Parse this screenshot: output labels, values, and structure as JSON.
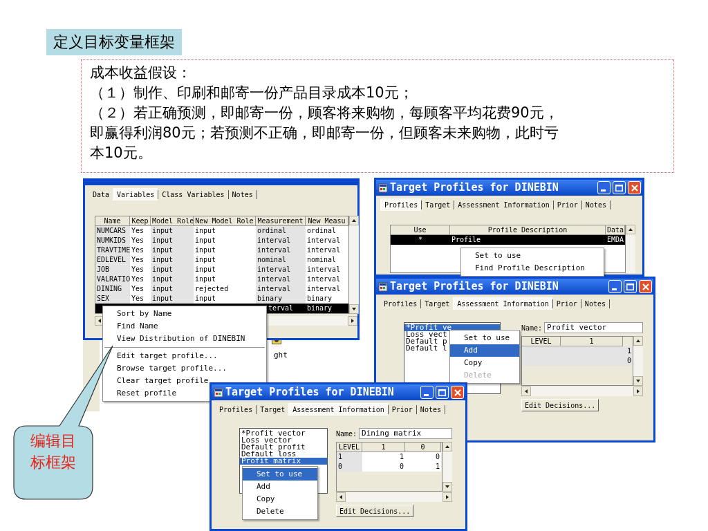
{
  "slide_title": "定义目标变量框架",
  "note_lines": [
    "成本收益假设：",
    "（１）制作、印刷和邮寄一份产品目录成本10元；",
    "（２）若正确预测，即邮寄一份，顾客将来购物，每顾客平均花费90元，",
    "即赢得利润80元；若预测不正确，即邮寄一份，但顾客未来购物，此时亏",
    "本10元。"
  ],
  "behind_text": "ght",
  "windows": [
    {
      "kind": "variables",
      "tabs": [
        {
          "label": "Data",
          "selected": false
        },
        {
          "label": "Variables",
          "selected": true
        },
        {
          "label": "Class Variables",
          "selected": false
        },
        {
          "label": "Notes",
          "selected": false
        }
      ],
      "table": {
        "columns": [
          "Name",
          "Keep",
          "Model Role",
          "New Model Role",
          "Measurement",
          "New Measu"
        ],
        "rows": [
          {
            "cells": [
              "NUMCARS",
              "Yes",
              "input",
              "input",
              "ordinal",
              "ordinal"
            ],
            "selected": false
          },
          {
            "cells": [
              "NUMKIDS",
              "Yes",
              "input",
              "input",
              "interval",
              "interval"
            ],
            "selected": false
          },
          {
            "cells": [
              "TRAVTIME",
              "Yes",
              "input",
              "input",
              "interval",
              "interval"
            ],
            "selected": false
          },
          {
            "cells": [
              "EDLEVEL",
              "Yes",
              "input",
              "input",
              "nominal",
              "nominal"
            ],
            "selected": false
          },
          {
            "cells": [
              "JOB",
              "Yes",
              "input",
              "input",
              "interval",
              "interval"
            ],
            "selected": false
          },
          {
            "cells": [
              "VALRATIO",
              "Yes",
              "input",
              "input",
              "interval",
              "interval"
            ],
            "selected": false
          },
          {
            "cells": [
              "DINING",
              "Yes",
              "input",
              "rejected",
              "interval",
              "interval"
            ],
            "selected": false
          },
          {
            "cells": [
              "SEX",
              "Yes",
              "input",
              "input",
              "binary",
              "binary"
            ],
            "selected": false
          },
          {
            "cells": [
              "",
              "",
              "",
              "",
              "terval",
              "binary"
            ],
            "selected": true
          }
        ]
      },
      "context_menu": [
        {
          "kind": "item",
          "label": "Sort by Name",
          "selected": false,
          "disabled": false
        },
        {
          "kind": "item",
          "label": "Find Name",
          "selected": false,
          "disabled": false
        },
        {
          "kind": "item",
          "label": "View Distribution of DINEBIN",
          "selected": false,
          "disabled": false
        },
        {
          "kind": "separator"
        },
        {
          "kind": "item",
          "label": "Edit target profile...",
          "selected": false,
          "disabled": false
        },
        {
          "kind": "item",
          "label": "Browse target profile...",
          "selected": false,
          "disabled": false
        },
        {
          "kind": "item",
          "label": "Clear target profile",
          "selected": false,
          "disabled": false
        },
        {
          "kind": "item",
          "label": "Reset profile",
          "selected": false,
          "disabled": false
        }
      ]
    },
    {
      "kind": "profiles",
      "title": "Target Profiles for DINEBIN",
      "tabs": [
        {
          "label": "Profiles",
          "selected": true
        },
        {
          "label": "Target",
          "selected": false
        },
        {
          "label": "Assessment Information",
          "selected": false
        },
        {
          "label": "Prior",
          "selected": false
        },
        {
          "label": "Notes",
          "selected": false
        }
      ],
      "table": {
        "columns": [
          "Use",
          "Profile Description",
          "Data"
        ],
        "rows": [
          {
            "cells": [
              "*",
              "Profile",
              "EMDA"
            ],
            "selected": true
          }
        ]
      },
      "context_menu": [
        {
          "kind": "item",
          "label": "Set to use",
          "selected": false,
          "disabled": false
        },
        {
          "kind": "item",
          "label": "Find Profile Description",
          "selected": false,
          "disabled": false
        }
      ]
    },
    {
      "kind": "matrices",
      "title": "Target Profiles for DINEBIN",
      "tabs": [
        {
          "label": "Profiles",
          "selected": false
        },
        {
          "label": "Target",
          "selected": false
        },
        {
          "label": "Assessment Information",
          "selected": true
        },
        {
          "label": "Prior",
          "selected": false
        },
        {
          "label": "Notes",
          "selected": false
        }
      ],
      "list": [
        {
          "label": "*Profit ve",
          "selected": true
        },
        {
          "label": "Loss vect",
          "selected": false
        },
        {
          "label": "Default p",
          "selected": false
        },
        {
          "label": "Default l",
          "selected": false
        }
      ],
      "context_menu": [
        {
          "kind": "item",
          "label": "Set to use",
          "selected": false,
          "disabled": false
        },
        {
          "kind": "item",
          "label": "Add",
          "selected": true,
          "disabled": false
        },
        {
          "kind": "item",
          "label": "Copy",
          "selected": false,
          "disabled": false
        },
        {
          "kind": "item",
          "label": "Delete",
          "selected": false,
          "disabled": true
        }
      ],
      "name_label": "Name:",
      "name_value": "Profit vector",
      "grid": {
        "columns": [
          "LEVEL",
          "1"
        ],
        "rows": [
          {
            "cells": [
              "1"
            ]
          },
          {
            "cells": [
              "0"
            ]
          }
        ]
      },
      "button": "Edit Decisions..."
    },
    {
      "kind": "matrices",
      "title": "Target Profiles for DINEBIN",
      "tabs": [
        {
          "label": "Profiles",
          "selected": false
        },
        {
          "label": "Target",
          "selected": false
        },
        {
          "label": "Assessment Information",
          "selected": true
        },
        {
          "label": "Prior",
          "selected": false
        },
        {
          "label": "Notes",
          "selected": false
        }
      ],
      "list": [
        {
          "label": "*Profit vector",
          "selected": false
        },
        {
          "label": "Loss vector",
          "selected": false
        },
        {
          "label": "Default profit",
          "selected": false
        },
        {
          "label": "Default loss",
          "selected": false
        },
        {
          "label": "Profit matrix",
          "selected": true
        }
      ],
      "context_menu": [
        {
          "kind": "item",
          "label": "Set to use",
          "selected": true,
          "disabled": false
        },
        {
          "kind": "item",
          "label": "Add",
          "selected": false,
          "disabled": false
        },
        {
          "kind": "item",
          "label": "Copy",
          "selected": false,
          "disabled": false
        },
        {
          "kind": "item",
          "label": "Delete",
          "selected": false,
          "disabled": false
        }
      ],
      "name_label": "Name:",
      "name_value": "Dining matrix",
      "grid": {
        "columns": [
          "LEVEL",
          "1",
          "0"
        ],
        "rows": [
          {
            "cells": [
              "1",
              "1",
              "0"
            ]
          },
          {
            "cells": [
              "0",
              "0",
              "1"
            ]
          }
        ]
      },
      "button": "Edit Decisions..."
    }
  ],
  "callout": "编辑目标框架"
}
